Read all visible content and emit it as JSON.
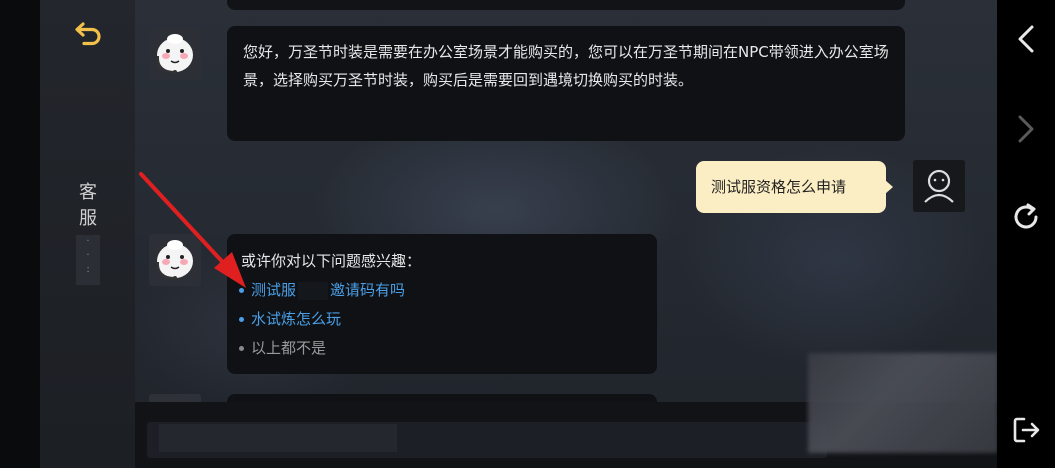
{
  "sidebar": {
    "label": "客服",
    "dots": "·\n:"
  },
  "messages": [
    {
      "role": "agent",
      "text": "您好，万圣节时装是需要在办公室场景才能购买的，您可以在万圣节期间在NPC带领进入办公室场景，选择购买万圣节时装，购买后是需要回到遇境切换购买的时装。"
    },
    {
      "role": "user",
      "text": "测试服资格怎么申请"
    }
  ],
  "suggestions": {
    "intro": "或许你对以下问题感兴趣：",
    "item1_prefix": "测试服",
    "item1_suffix": "邀请码有吗",
    "item2": "水试炼怎么玩",
    "item3": "以上都不是"
  },
  "colors": {
    "user_bubble": "#fbedc4",
    "link": "#4a9fe6",
    "arrow": "#e02020"
  },
  "icons": {
    "back": "return-arrow-icon",
    "nav_back": "chevron-left-icon",
    "nav_forward": "chevron-right-icon",
    "refresh": "refresh-icon",
    "exit": "exit-icon"
  }
}
